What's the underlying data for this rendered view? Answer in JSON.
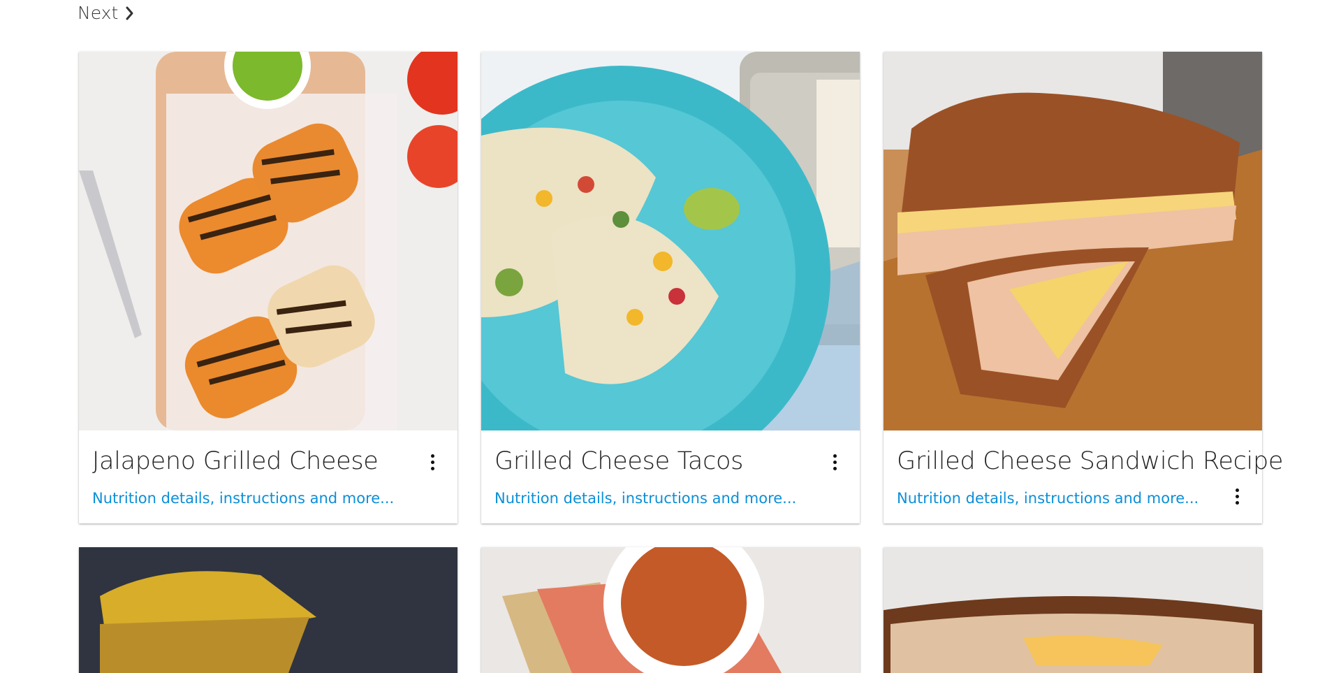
{
  "nav": {
    "next_label": "Next"
  },
  "cards": [
    {
      "title": "Jalapeno Grilled Cheese",
      "link": "Nutrition details, instructions and more..."
    },
    {
      "title": "Grilled Cheese Tacos",
      "link": "Nutrition details, instructions and more..."
    },
    {
      "title": "Grilled Cheese Sandwich Recipe",
      "link": "Nutrition details, instructions and more..."
    }
  ],
  "icons": {
    "next": "chevron-right-icon",
    "menu": "more-vertical-icon"
  },
  "colors": {
    "link": "#0b8fd8",
    "title": "#222222"
  }
}
